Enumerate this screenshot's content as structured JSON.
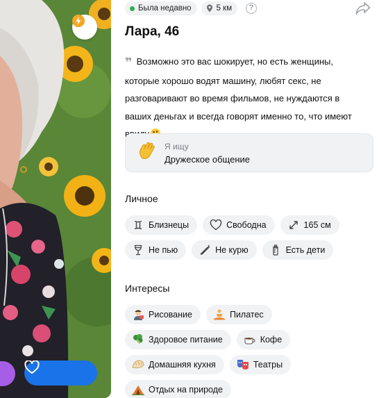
{
  "status": {
    "online": "Была недавно",
    "distance": "5 км",
    "help": "?"
  },
  "profile": {
    "name_age": "Лара, 46",
    "about": "Возможно это вас шокирует, но есть женщины, которые хорошо водят машину, любят секс, не разговаривают во время фильмов, не нуждаются в ваших деньгах и всегда говорят именно то, что имеют ввиду.",
    "quote_mark": "❞"
  },
  "seeking": {
    "label": "Я ищу",
    "value": "Дружеское общение",
    "icon": "waving-hand-icon"
  },
  "personal": {
    "title": "Личное",
    "items": [
      {
        "label": "Близнецы",
        "icon": "gemini-icon"
      },
      {
        "label": "Свободна",
        "icon": "heart-outline-icon"
      },
      {
        "label": "165 см",
        "icon": "height-arrows-icon"
      },
      {
        "label": "Не пью",
        "icon": "wine-glass-icon"
      },
      {
        "label": "Не курю",
        "icon": "cigarette-icon"
      },
      {
        "label": "Есть дети",
        "icon": "baby-bottle-icon"
      }
    ]
  },
  "interests": {
    "title": "Интересы",
    "items": [
      {
        "label": "Рисование",
        "icon": "artist-icon"
      },
      {
        "label": "Пилатес",
        "icon": "lotus-position-icon"
      },
      {
        "label": "Здоровое питание",
        "icon": "broccoli-icon"
      },
      {
        "label": "Кофе",
        "icon": "coffee-icon"
      },
      {
        "label": "Домашняя кухня",
        "icon": "dumpling-icon"
      },
      {
        "label": "Театры",
        "icon": "theater-masks-icon"
      },
      {
        "label": "Отдых на природе",
        "icon": "camping-icon"
      }
    ]
  },
  "colors": {
    "accent": "#1a73e8",
    "secondary_action": "#a65ee6",
    "online": "#2bb24c",
    "chip_bg": "#f1f2f4"
  }
}
